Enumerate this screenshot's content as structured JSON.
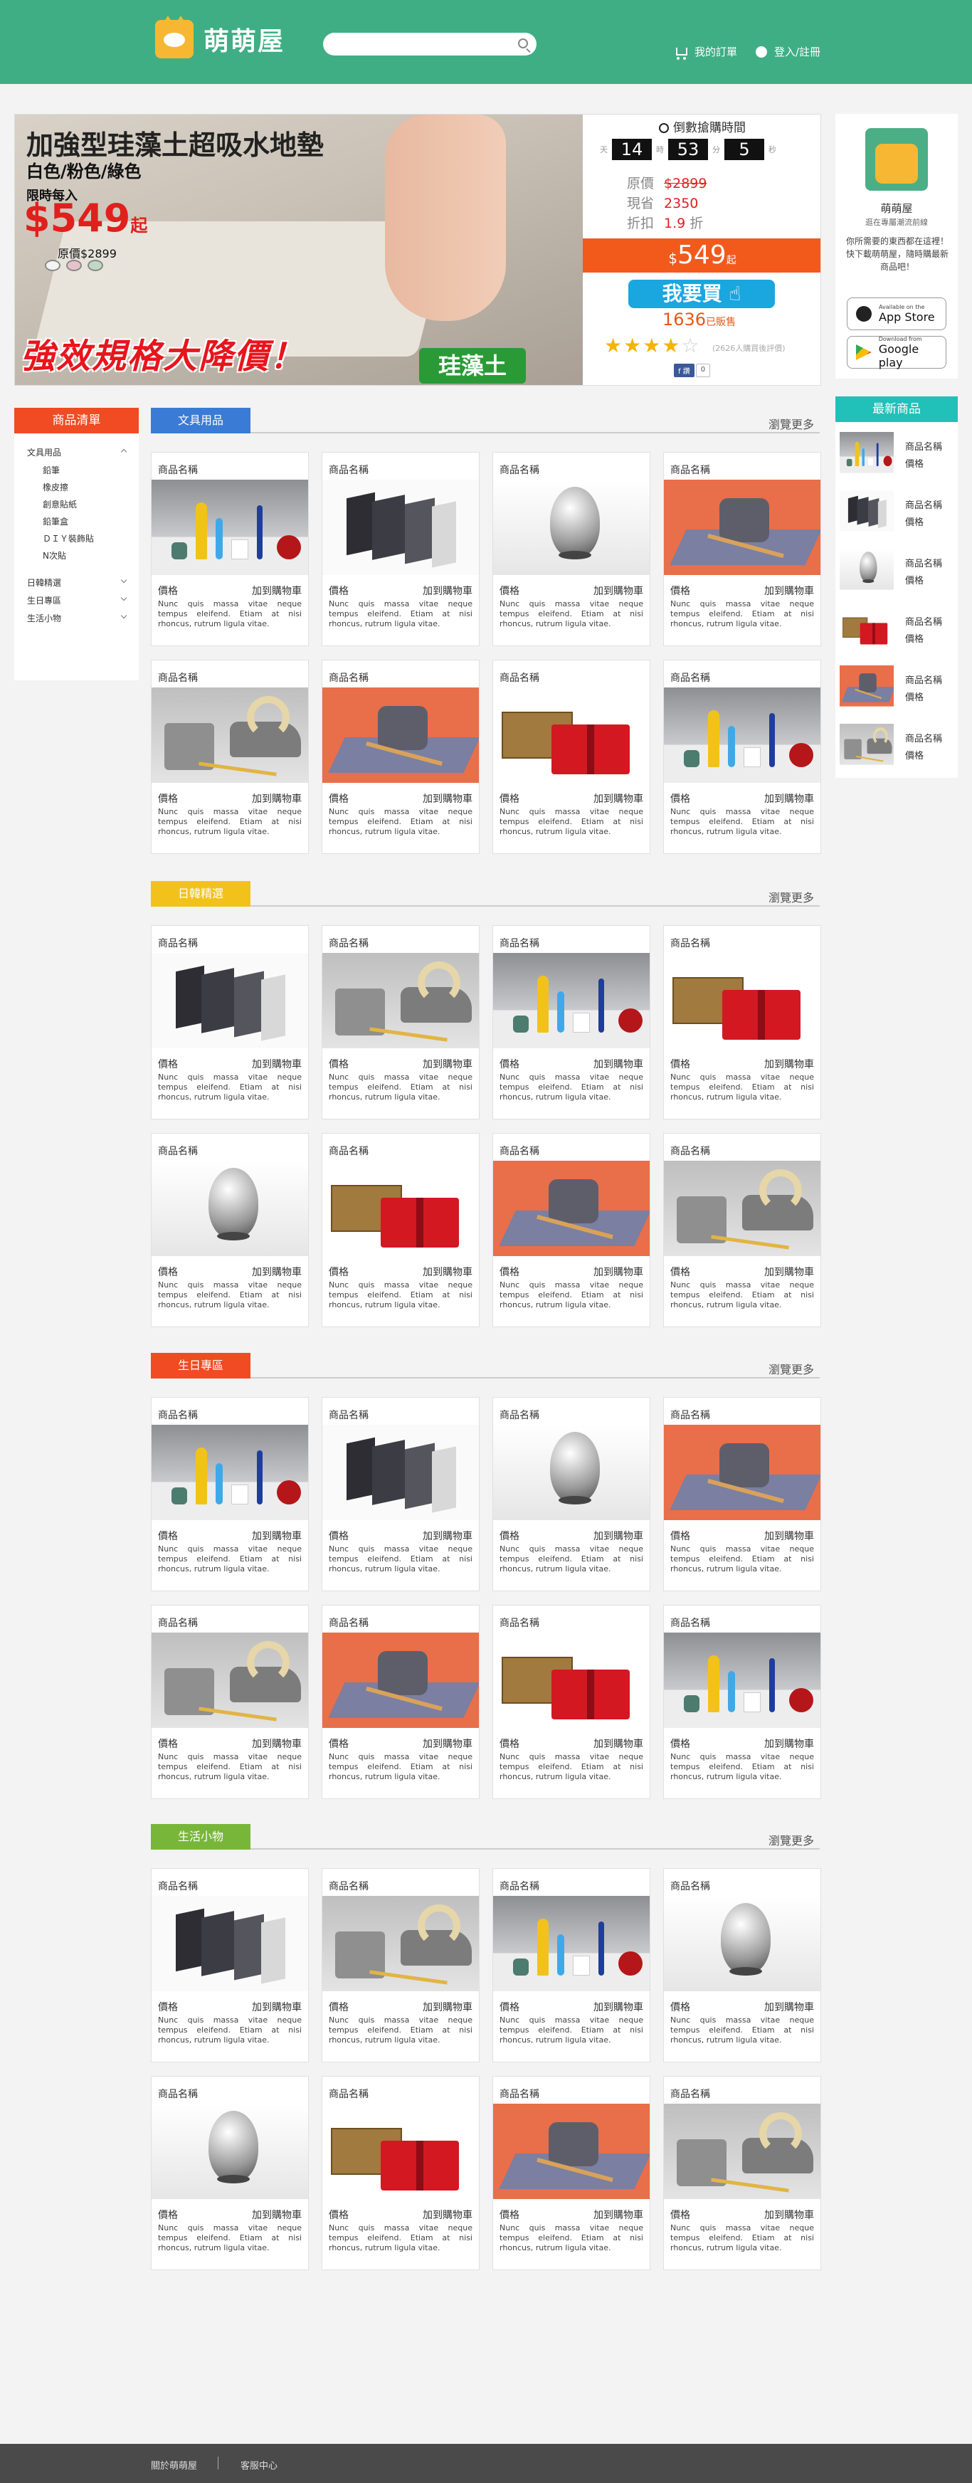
{
  "brand": {
    "name": "萌萌屋"
  },
  "search": {
    "placeholder": ""
  },
  "nav": {
    "orders": "我的訂單",
    "login": "登入/註冊"
  },
  "banner": {
    "title": "加強型珪藻土超吸水地墊",
    "colors": "白色/粉色/綠色",
    "promo_label": "限時每入",
    "price_symbol": "$",
    "price": "549",
    "price_suffix": "起",
    "original": "原價$2899",
    "slogan": "強效規格大降價！",
    "material": "珪藻土"
  },
  "deal": {
    "heading": "倒數搶購時間",
    "days_label": "天",
    "days": "14",
    "hours_label": "時",
    "hours": "53",
    "mins_label": "分",
    "mins": "5",
    "secs_label": "秒",
    "orig_label": "原價",
    "orig_value": "$2899",
    "now_label": "現省",
    "now_value": "2350",
    "disc_label": "折扣",
    "disc_value": "1.9",
    "disc_unit": "折",
    "price_symbol": "$",
    "price": "549",
    "price_suffix": "起",
    "buy_label": "我要買",
    "sold": "1636",
    "sold_suffix": "已販售",
    "rating": 4,
    "rated_text": "(2626人購買後評價)",
    "fb_share": "f 讚",
    "fb_count": "0"
  },
  "sidebar": {
    "heading": "商品清單",
    "cats": [
      {
        "label": "文具用品",
        "open": true,
        "subs": [
          "鉛筆",
          "橡皮擦",
          "創意貼紙",
          "鉛筆盒",
          "ＤＩＹ裝飾貼",
          "N次貼"
        ]
      },
      {
        "label": "日韓精選",
        "open": false,
        "subs": []
      },
      {
        "label": "生日專區",
        "open": false,
        "subs": []
      },
      {
        "label": "生活小物",
        "open": false,
        "subs": []
      }
    ]
  },
  "app": {
    "name": "萌萌屋",
    "sub": "逛在專屬潮流前線",
    "desc": "你所需要的東西都在這裡！快下載萌萌屋，隨時購最新商品吧！",
    "appstore_small": "Available on the",
    "appstore": "App Store",
    "google_small": "Download from",
    "google": "Google play"
  },
  "new_products": {
    "heading": "最新商品",
    "items": [
      {
        "name": "商品名稱",
        "price": "價格",
        "thumb": "bottles"
      },
      {
        "name": "商品名稱",
        "price": "價格",
        "thumb": "letters"
      },
      {
        "name": "商品名稱",
        "price": "價格",
        "thumb": "chrome"
      },
      {
        "name": "商品名稱",
        "price": "價格",
        "thumb": "gift"
      },
      {
        "name": "商品名稱",
        "price": "價格",
        "thumb": "sharpener"
      },
      {
        "name": "商品名稱",
        "price": "價格",
        "thumb": "tape"
      }
    ]
  },
  "card_text": {
    "name": "商品名稱",
    "price": "價格",
    "cart": "加到購物車",
    "desc": "Nunc quis massa vitae neque tempus eleifend. Etiam at nisi rhoncus, rutrum ligula vitae."
  },
  "sections": [
    {
      "title": "文具用品",
      "more": "瀏覽更多",
      "color": "#3a7bd5",
      "images": [
        "bottles",
        "letters",
        "chrome",
        "sharpener",
        "tape",
        "sharpener",
        "gift",
        "bottles"
      ]
    },
    {
      "title": "日韓精選",
      "more": "瀏覽更多",
      "color": "#f2c21b",
      "images": [
        "letters",
        "tape",
        "bottles",
        "gift",
        "chrome",
        "gift",
        "sharpener",
        "tape"
      ]
    },
    {
      "title": "生日專區",
      "more": "瀏覽更多",
      "color": "#f04b23",
      "images": [
        "bottles",
        "letters",
        "chrome",
        "sharpener",
        "tape",
        "sharpener",
        "gift",
        "bottles"
      ]
    },
    {
      "title": "生活小物",
      "more": "瀏覽更多",
      "color": "#78b63a",
      "images": [
        "letters",
        "tape",
        "bottles",
        "chrome",
        "chrome",
        "gift",
        "sharpener",
        "tape"
      ]
    }
  ],
  "footer": {
    "about": "關於萌萌屋",
    "service": "客服中心"
  }
}
